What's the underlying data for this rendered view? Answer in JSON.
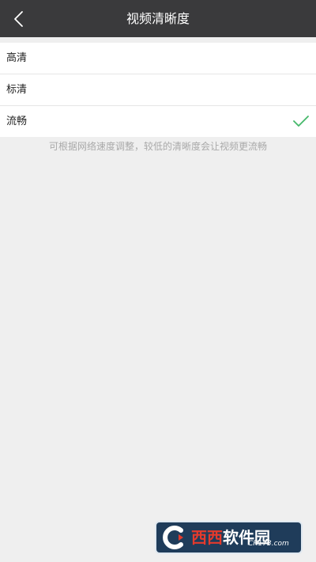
{
  "header": {
    "title": "视频清晰度"
  },
  "quality_options": [
    {
      "label": "高清",
      "selected": false
    },
    {
      "label": "标清",
      "selected": false
    },
    {
      "label": "流畅",
      "selected": true
    }
  ],
  "hint": "可根据网络速度调整，较低的清晰度会让视频更流畅",
  "icons": {
    "back": "chevron-left-icon",
    "selected": "check-icon"
  },
  "colors": {
    "navbar_bg": "#3a3a3c",
    "check": "#45b86a",
    "page_bg": "#efefef"
  },
  "watermark": {
    "brand_red": "西西",
    "brand_white": "软件园",
    "domain": "CR173.com"
  }
}
